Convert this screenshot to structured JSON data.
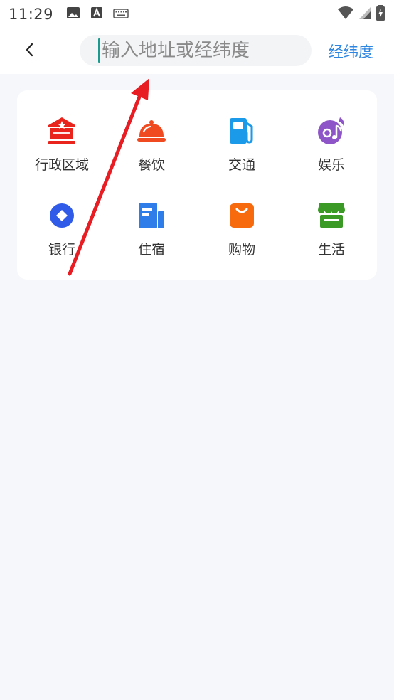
{
  "status_bar": {
    "time": "11:29",
    "icons_left": [
      "image-icon",
      "font-a-icon",
      "keyboard-icon"
    ],
    "icons_right": [
      "wifi-icon",
      "cell-signal-icon",
      "battery-charging-icon"
    ]
  },
  "header": {
    "back_icon": "chevron-left-icon",
    "search_placeholder": "输入地址或经纬度",
    "search_value": "",
    "latlng_label": "经纬度"
  },
  "categories": [
    {
      "label": "行政区域",
      "icon": "government-building-icon",
      "color": "#e8241c"
    },
    {
      "label": "餐饮",
      "icon": "food-cloche-icon",
      "color": "#f04a20"
    },
    {
      "label": "交通",
      "icon": "gas-station-icon",
      "color": "#1a9ae8"
    },
    {
      "label": "娱乐",
      "icon": "music-disc-icon",
      "color": "#8e55c8"
    },
    {
      "label": "银行",
      "icon": "bank-diamond-icon",
      "color": "#2f5be8"
    },
    {
      "label": "住宿",
      "icon": "hotel-building-icon",
      "color": "#2f7de8"
    },
    {
      "label": "购物",
      "icon": "shopping-bag-icon",
      "color": "#f76b0e"
    },
    {
      "label": "生活",
      "icon": "storefront-icon",
      "color": "#3a9a25"
    }
  ],
  "colors": {
    "accent": "#2f86e0",
    "caret": "#1a9b8e",
    "annotation_arrow": "#e81c23",
    "page_background": "#f6f7fa"
  }
}
